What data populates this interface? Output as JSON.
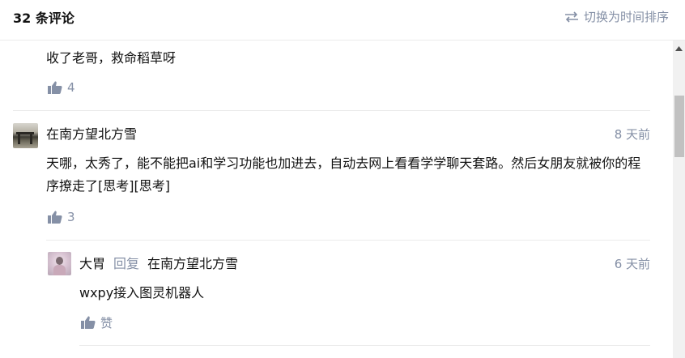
{
  "header": {
    "comment_count": "32 条评论",
    "sort_toggle_label": "切换为时间排序"
  },
  "comments": [
    {
      "text": "收了老哥，救命稻草呀",
      "likes": "4"
    },
    {
      "author": "在南方望北方雪",
      "time": "8 天前",
      "text": "天哪，太秀了，能不能把ai和学习功能也加进去，自动去网上看看学学聊天套路。然后女朋友就被你的程序撩走了[思考][思考]",
      "likes": "3",
      "replies": [
        {
          "author": "大胃",
          "reply_word": "回复",
          "reply_to": "在南方望北方雪",
          "time": "6 天前",
          "text": "wxpy接入图灵机器人",
          "likes": "赞"
        }
      ]
    }
  ],
  "icons": {
    "sort": "swap-arrows-icon",
    "like": "thumbs-up-icon",
    "scroll_up": "triangle-up-icon"
  },
  "colors": {
    "muted": "#8590a6",
    "text": "#121212",
    "divider": "#ebebeb"
  }
}
